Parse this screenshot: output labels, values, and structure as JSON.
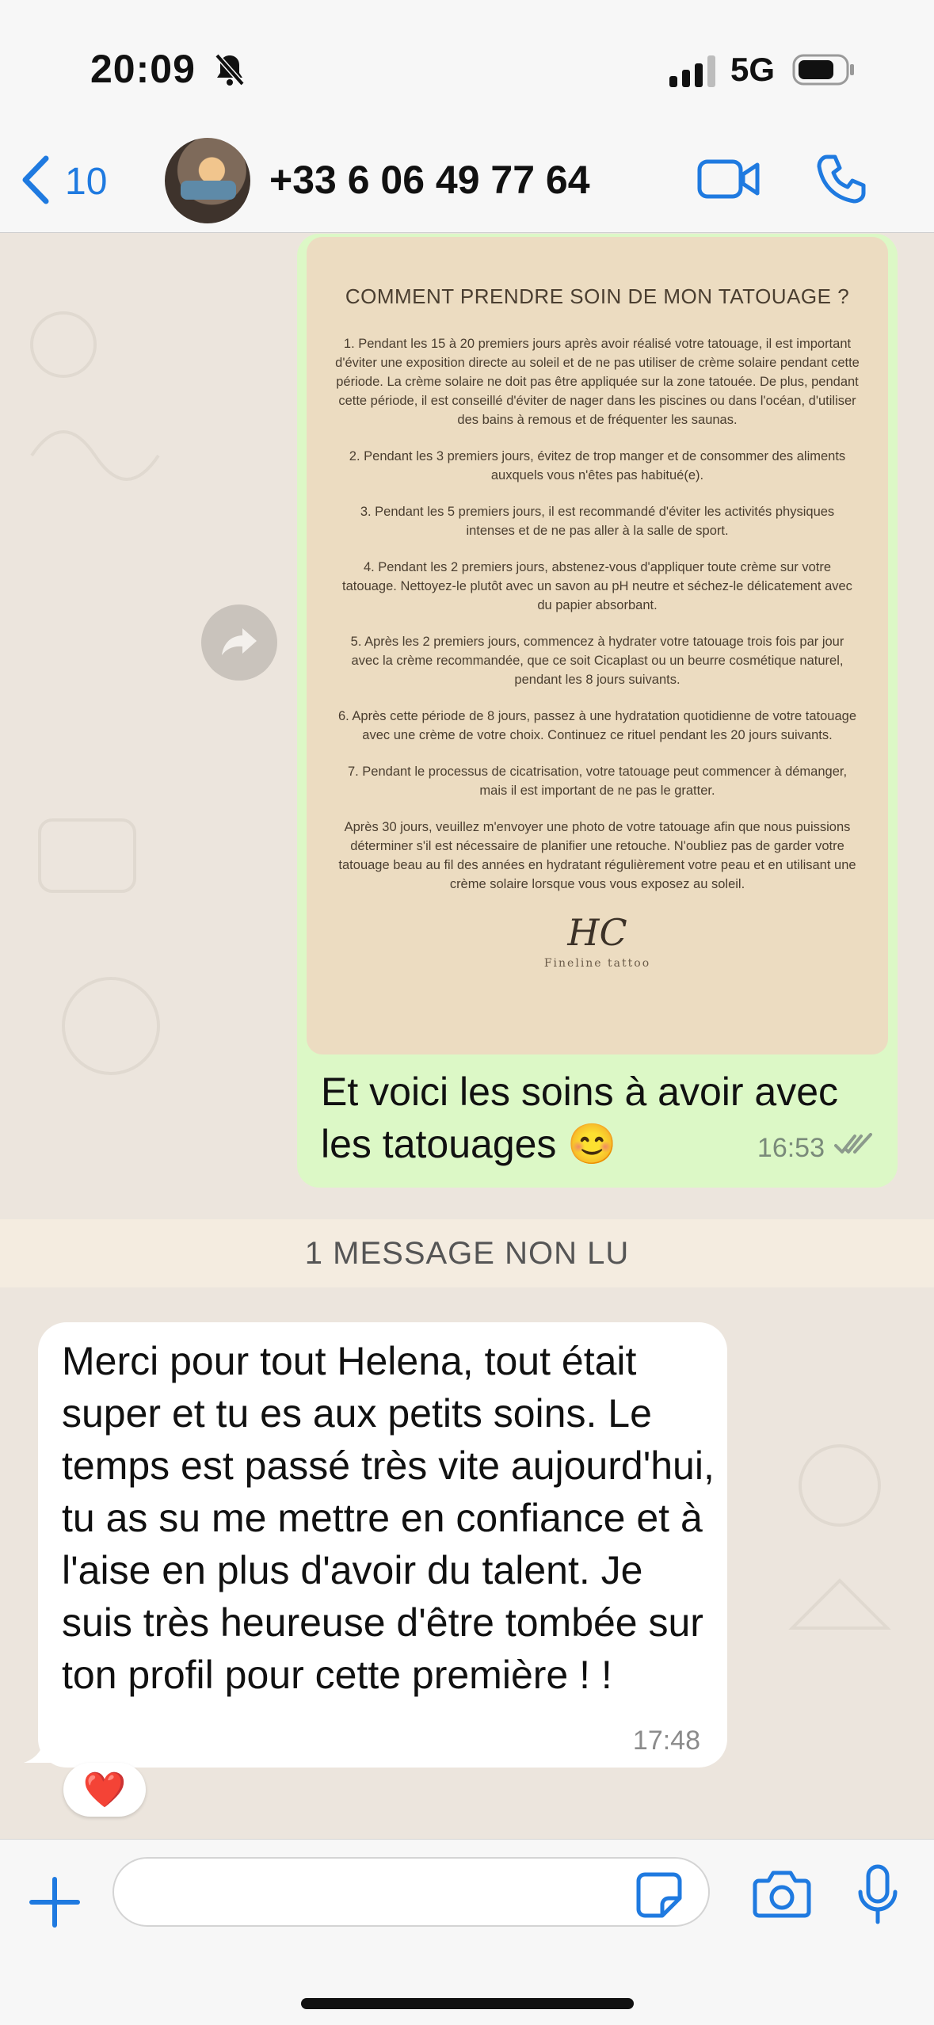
{
  "status_bar": {
    "time": "20:09",
    "network": "5G",
    "icons": [
      "bell-slash-icon",
      "signal-icon",
      "battery-icon"
    ]
  },
  "header": {
    "back_count": "10",
    "contact_name": "+33 6 06 49 77 64",
    "icons": [
      "chevron-left-icon",
      "video-camera-icon",
      "phone-icon"
    ]
  },
  "outgoing_message": {
    "document": {
      "title": "COMMENT PRENDRE SOIN DE MON TATOUAGE ?",
      "paragraphs": [
        "1. Pendant les 15 à 20 premiers jours après avoir réalisé votre tatouage, il est important d'éviter une exposition directe au soleil et de ne pas utiliser de crème solaire pendant cette période. La crème solaire ne doit pas être appliquée sur la zone tatouée. De plus, pendant cette période, il est conseillé d'éviter de nager dans les piscines ou dans l'océan, d'utiliser des bains à remous et de fréquenter les saunas.",
        "2. Pendant les 3 premiers jours, évitez de trop manger et de consommer des aliments auxquels vous n'êtes pas habitué(e).",
        "3. Pendant les 5 premiers jours, il est recommandé d'éviter les activités physiques intenses et de ne pas aller à la salle de sport.",
        "4. Pendant les 2 premiers jours, abstenez-vous d'appliquer toute crème sur votre tatouage. Nettoyez-le plutôt avec un savon au pH neutre et séchez-le délicatement avec du papier absorbant.",
        "5. Après les 2 premiers jours, commencez à hydrater votre tatouage trois fois par jour avec la crème recommandée, que ce soit Cicaplast ou un beurre cosmétique naturel, pendant les 8 jours suivants.",
        "6. Après cette période de 8 jours, passez à une hydratation quotidienne de votre tatouage avec une crème de votre choix. Continuez ce rituel pendant les 20 jours suivants.",
        "7. Pendant le processus de cicatrisation, votre tatouage peut commencer à démanger, mais il est important de ne pas le gratter.",
        "Après 30 jours, veuillez m'envoyer une photo de votre tatouage afin que nous puissions déterminer s'il est nécessaire de planifier une retouche. N'oubliez pas de garder votre tatouage beau au fil des années en hydratant régulièrement votre peau et en utilisant une crème solaire lorsque vous vous exposez au soleil."
      ],
      "logo_mark": "HC",
      "logo_subtitle": "Fineline tattoo"
    },
    "caption": "Et voici les soins à avoir avec les tatouages 😊",
    "time": "16:53",
    "status_icon": "double-check-icon"
  },
  "unread_divider": "1 MESSAGE NON LU",
  "incoming_message": {
    "text": "Merci pour tout Helena, tout était super et tu es aux petits soins. Le temps est passé très vite aujourd'hui, tu as su me mettre en confiance et à l'aise en plus d'avoir du talent. Je suis très heureuse d'être tombée sur ton profil pour cette première ! !",
    "time": "17:48",
    "reaction": "❤️"
  },
  "input_bar": {
    "placeholder": "",
    "icons": [
      "plus-icon",
      "sticker-icon",
      "camera-icon",
      "microphone-icon"
    ]
  },
  "colors": {
    "accent": "#1f7ae0",
    "outgoing_bubble": "#dcf8c6",
    "incoming_bubble": "#ffffff",
    "chat_background": "#ece5dd",
    "document_background": "#ecdcc1"
  }
}
